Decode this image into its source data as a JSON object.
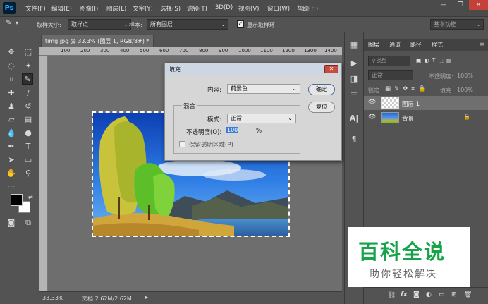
{
  "app": {
    "logo": "Ps"
  },
  "menu": [
    "文件(F)",
    "编辑(E)",
    "图像(I)",
    "图层(L)",
    "文字(Y)",
    "选择(S)",
    "滤镜(T)",
    "3D(D)",
    "视图(V)",
    "窗口(W)",
    "帮助(H)"
  ],
  "window_controls": {
    "minimize": "—",
    "restore": "❐",
    "close": "✕"
  },
  "options": {
    "sample_size_label": "取样大小:",
    "sample_size_value": "取样点",
    "sample_label": "样本:",
    "sample_value": "所有图层",
    "show_ring_label": "显示取样环",
    "show_ring_checked": true,
    "workspace": "基本功能"
  },
  "document": {
    "tab_title": "timg.jpg @ 33.3% (图层 1, RGB/8#) *",
    "tab_close": "×",
    "ruler_ticks": [
      "100",
      "200",
      "300",
      "400",
      "500",
      "600",
      "700",
      "800",
      "900",
      "1000",
      "1100",
      "1200",
      "1300",
      "1400"
    ]
  },
  "status": {
    "zoom": "33.33%",
    "doc": "文档:2.62M/2.62M"
  },
  "dialog": {
    "title": "填充",
    "contents_label": "内容:",
    "contents_value": "前景色",
    "ok_label": "确定",
    "reset_label": "复位",
    "blend_title": "混合",
    "mode_label": "模式:",
    "mode_value": "正常",
    "opacity_label": "不透明度(O):",
    "opacity_value": "100",
    "opacity_unit": "%",
    "preserve_label": "保留透明区域(P)"
  },
  "layers_panel": {
    "tabs": [
      "图层",
      "通道",
      "路径",
      "样式"
    ],
    "kind_filter": "类型",
    "blend_mode": "正常",
    "opacity_label": "不透明度:",
    "opacity_value": "100%",
    "lock_label": "锁定:",
    "fill_label": "填充:",
    "fill_value": "100%",
    "layers": [
      {
        "name": "图层 1",
        "selected": true
      },
      {
        "name": "背景",
        "locked": true
      }
    ],
    "bottom_icons": [
      "link-icon",
      "fx-icon",
      "mask-icon",
      "adjustment-icon",
      "group-icon",
      "new-layer-icon",
      "trash-icon"
    ],
    "fx_label": "fx"
  },
  "watermark": {
    "title": "百科全说",
    "subtitle": "助你轻松解决"
  },
  "colors": {
    "foreground": "#000000",
    "background": "#ffffff",
    "accent": "#31a8ff",
    "watermark_green": "#17a34a"
  }
}
